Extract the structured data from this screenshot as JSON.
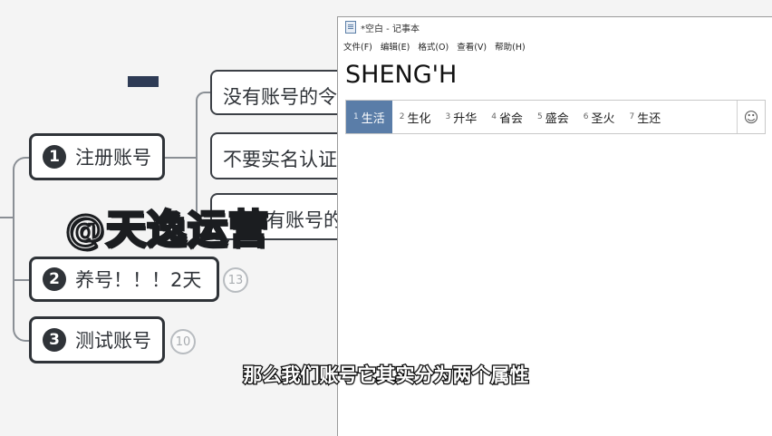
{
  "mindmap": {
    "nodes": [
      {
        "num": "1",
        "label": "注册账号"
      },
      {
        "num": "2",
        "label": "养号！！！2天",
        "count": "13"
      },
      {
        "num": "3",
        "label": "测试账号",
        "count": "10"
      }
    ],
    "children": [
      {
        "label": "没有账号的令"
      },
      {
        "label": "不要实名认证"
      },
      {
        "label": "有账号的"
      }
    ]
  },
  "watermark": "@天逸运营",
  "notepad": {
    "title": "*空白 - 记事本",
    "menu": [
      "文件(F)",
      "编辑(E)",
      "格式(O)",
      "查看(V)",
      "帮助(H)"
    ],
    "text": "SHENG'H"
  },
  "ime": {
    "candidates": [
      {
        "idx": "1",
        "text": "生活",
        "selected": true
      },
      {
        "idx": "2",
        "text": "生化"
      },
      {
        "idx": "3",
        "text": "升华"
      },
      {
        "idx": "4",
        "text": "省会"
      },
      {
        "idx": "5",
        "text": "盛会"
      },
      {
        "idx": "6",
        "text": "圣火"
      },
      {
        "idx": "7",
        "text": "生还"
      }
    ],
    "emoji_icon": "smiley-icon"
  },
  "subtitle": "那么我们账号它其实分为两个属性"
}
